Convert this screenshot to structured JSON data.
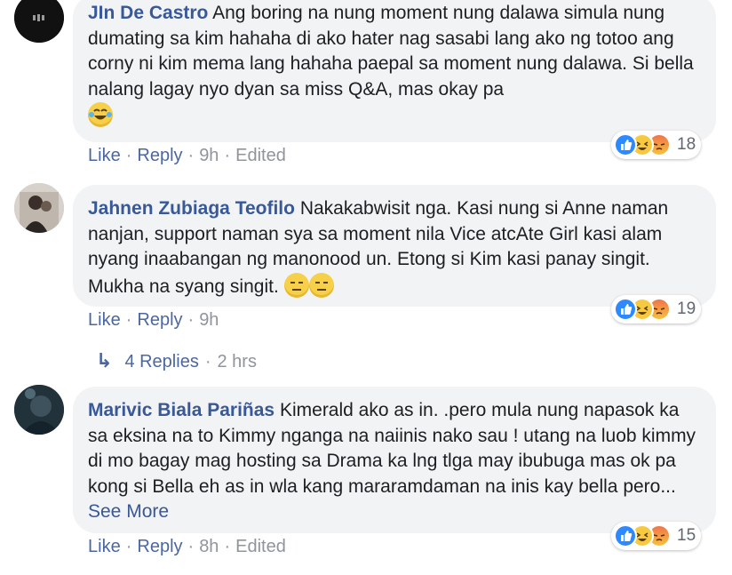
{
  "comments": [
    {
      "author": "JIn De Castro",
      "text": "Ang boring na nung moment nung dalawa simula nung dumating sa kim hahaha di ako hater nag sasabi lang ako ng totoo ang corny ni kim mema lang hahaha paepal sa moment nung dalawa. Si bella nalang lagay nyo dyan sa miss Q&A, mas okay pa",
      "emoji": [
        "tears-of-joy-emoji"
      ],
      "like_label": "Like",
      "reply_label": "Reply",
      "time": "9h",
      "edited": "Edited",
      "reactions": [
        "like",
        "haha",
        "angry"
      ],
      "reaction_count": "18"
    },
    {
      "author": "Jahnen Zubiaga Teofilo",
      "text": "Nakakabwisit nga. Kasi nung si Anne naman nanjan, support naman sya sa moment nila Vice atcAte Girl kasi alam nyang inaabangan ng manonood un. Etong si Kim kasi panay singit. Mukha na syang singit.",
      "emoji": [
        "expressionless-emoji",
        "expressionless-emoji"
      ],
      "like_label": "Like",
      "reply_label": "Reply",
      "time": "9h",
      "reactions": [
        "like",
        "haha",
        "angry"
      ],
      "reaction_count": "19",
      "replies_label": "4 Replies",
      "replies_time": "2 hrs"
    },
    {
      "author": "Marivic Biala Pariñas",
      "text": "Kimerald ako as in. .pero mula nung napasok ka sa eksina na to Kimmy nganga na naiinis nako sau ! utang na luob kimmy di mo bagay mag hosting sa Drama ka lng tlga may ibubuga mas ok pa kong si Bella eh as in wla kang mararamdaman na inis kay bella pero...",
      "see_more": "See More",
      "like_label": "Like",
      "reply_label": "Reply",
      "time": "8h",
      "edited": "Edited",
      "reactions": [
        "like",
        "haha",
        "angry"
      ],
      "reaction_count": "15"
    }
  ],
  "colors": {
    "name": "#385898",
    "bubble": "#f2f3f5",
    "meta": "#90949c",
    "action": "#4b67a1",
    "like": "#2e89ff"
  }
}
